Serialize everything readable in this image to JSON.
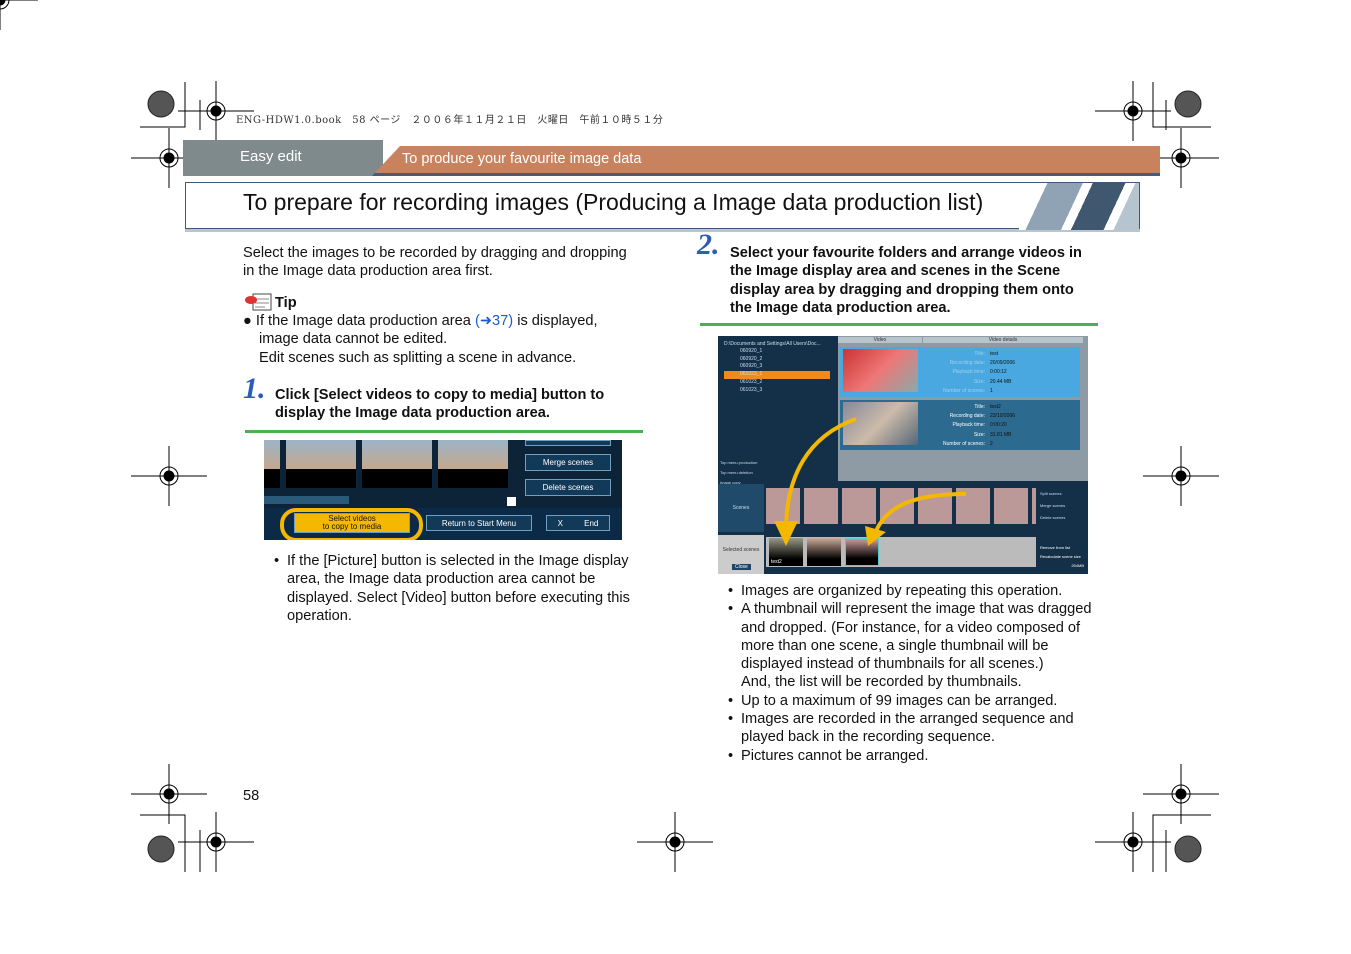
{
  "print_header": "ENG-HDW1.0.book　58 ページ　２００６年１１月２１日　火曜日　午前１０時５１分",
  "header": {
    "section": "Easy edit",
    "subsection": "To produce your favourite image data"
  },
  "title": "To prepare for recording images (Producing a Image data production list)",
  "intro": [
    "Select the images to be recorded by dragging and dropping",
    "in the Image data production area first."
  ],
  "tip": {
    "label": "Tip",
    "icon": "memo-icon",
    "text_before": "If the Image data production area ",
    "link": "(➜37)",
    "text_after": " is displayed,",
    "line2": "image data cannot be edited.",
    "line3": "Edit scenes such as splitting a scene in advance."
  },
  "step1": {
    "num": "1.",
    "line1": "Click [Select videos to copy to media] button to",
    "line2": "display the Image data production area."
  },
  "shot1": {
    "merge": "Merge scenes",
    "delete": "Delete scenes",
    "select1": "Select videos",
    "select2": "to copy to media",
    "return": "Return to Start Menu",
    "end_x": "X",
    "end": "End"
  },
  "step1_notes": [
    "If the [Picture] button is selected in the Image display",
    "area, the Image data production area cannot be",
    "displayed. Select [Video] button before executing this",
    "operation."
  ],
  "step2": {
    "num": "2.",
    "lines": [
      "Select your favourite folders and arrange videos in",
      "the Image display area and scenes in the Scene",
      "display area by dragging and dropping them onto",
      "the Image data production area."
    ]
  },
  "shot2": {
    "folder": "D:\\Documents and Settings\\All Users\\Doc...",
    "folders": [
      "060920_1",
      "060920_2",
      "060920_3",
      "061023_1",
      "061023_2",
      "061023_3"
    ],
    "selected_folder": "061023_1",
    "col_video": "Video",
    "col_details": "Video details",
    "videos": [
      {
        "title": "test",
        "date": "20/09/2006",
        "playback": "0:00:12",
        "size": "20.44 MB",
        "scenes": "1"
      },
      {
        "title": "test2",
        "date": "23/10/2006",
        "playback": "0:00:20",
        "size": "31.81 MB",
        "scenes": "2"
      }
    ],
    "labels": {
      "title": "Title:",
      "date": "Recording date:",
      "playback": "Playback time:",
      "size": "Size:",
      "scenes": "Number of scenes:"
    },
    "left_buttons": [
      "Top menu production",
      "Top menu deletion",
      "Image copy",
      "Image deletion"
    ],
    "scenes_label": "Scenes",
    "selected_label": "Selected scenes",
    "close": "Close",
    "thumb_label": "test2",
    "right_buttons": [
      "Split scenes",
      "Merge scenes",
      "Delete scenes"
    ],
    "bottom_buttons": [
      "Remove from list",
      "Recalculate scene size"
    ],
    "size_readout": "254MB"
  },
  "step2_notes": [
    "Images are organized by repeating this operation.",
    "A thumbnail will represent the image that was dragged|and dropped. (For instance, for a video composed of|more than one scene, a single thumbnail will be|displayed instead of thumbnails for all scenes.)|And, the list will be recorded by thumbnails.",
    "Up to a maximum of 99 images can be arranged.",
    "Images are recorded in the arranged sequence and|played back in the recording sequence.",
    "Pictures cannot be arranged."
  ],
  "page_number": "58",
  "colors": {
    "header_grey": "#7f8a8c",
    "header_orange": "#c8825e",
    "step_blue": "#2a5db5",
    "rule_green": "#4caf50",
    "highlight_yellow": "#f5b800"
  }
}
